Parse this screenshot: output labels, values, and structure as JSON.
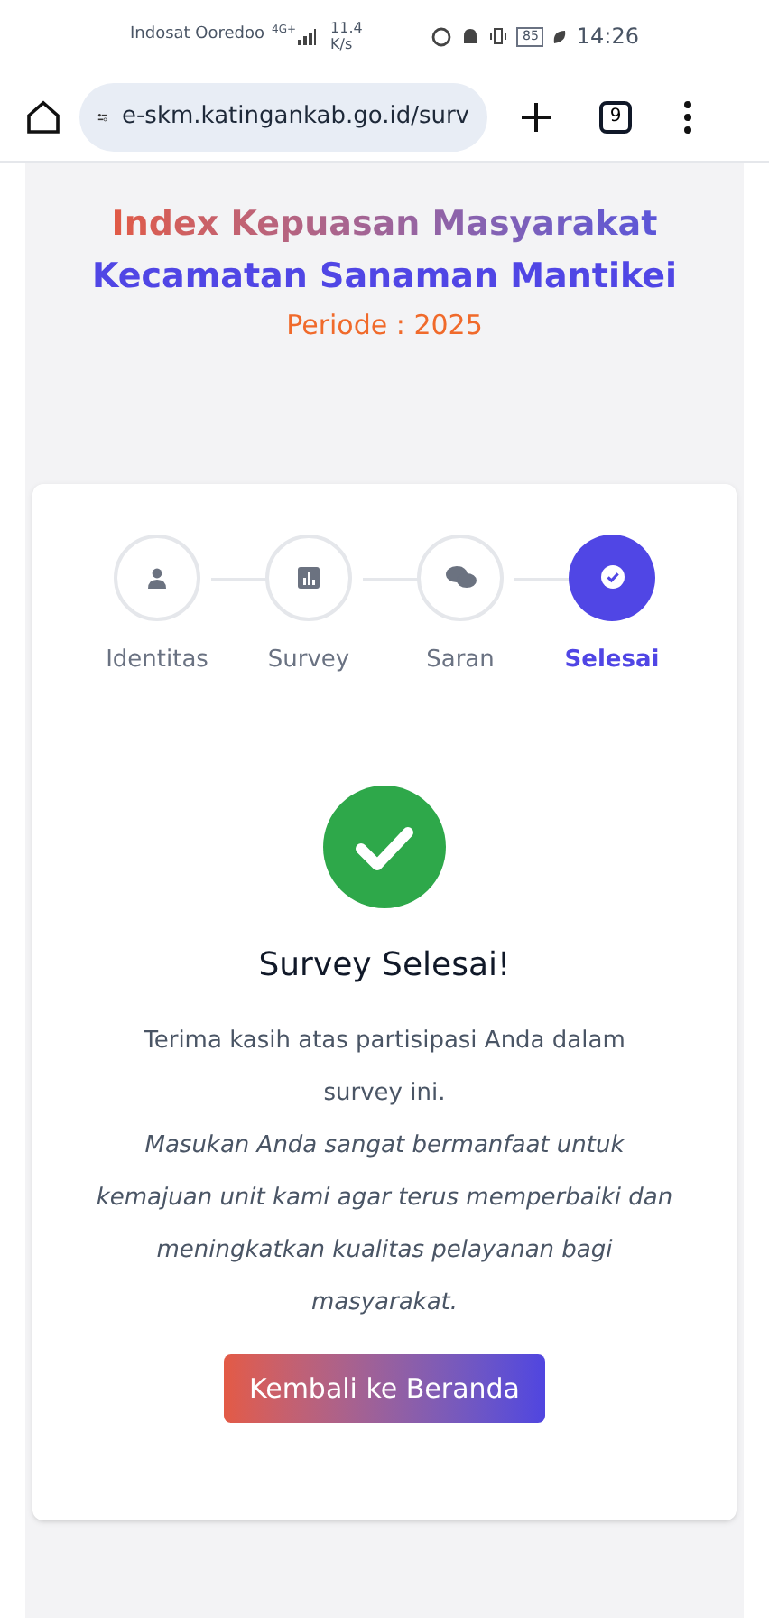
{
  "status_bar": {
    "carrier": "Indosat Ooredoo",
    "network": "4G+",
    "speed": "11.4",
    "speed_unit": "K/s",
    "battery": "85",
    "time": "14:26"
  },
  "browser": {
    "url": "e-skm.katingankab.go.id/surv",
    "tab_count": "9"
  },
  "header": {
    "title": "Index Kepuasan Masyarakat",
    "subtitle": "Kecamatan Sanaman Mantikei",
    "period": "Periode : 2025"
  },
  "steps": [
    {
      "label": "Identitas",
      "kind": "person",
      "selected": false
    },
    {
      "label": "Survey",
      "kind": "chart",
      "selected": false
    },
    {
      "label": "Saran",
      "kind": "chat",
      "selected": false
    },
    {
      "label": "Selesai",
      "kind": "check",
      "selected": true
    }
  ],
  "result": {
    "title": "Survey Selesai!",
    "message": "Terima kasih atas partisipasi Anda dalam survey ini.",
    "note": "Masukan Anda sangat bermanfaat untuk kemajuan unit kami agar terus memperbaiki dan meningkatkan kualitas pelayanan bagi masyarakat.",
    "button": "Kembali ke Beranda"
  }
}
